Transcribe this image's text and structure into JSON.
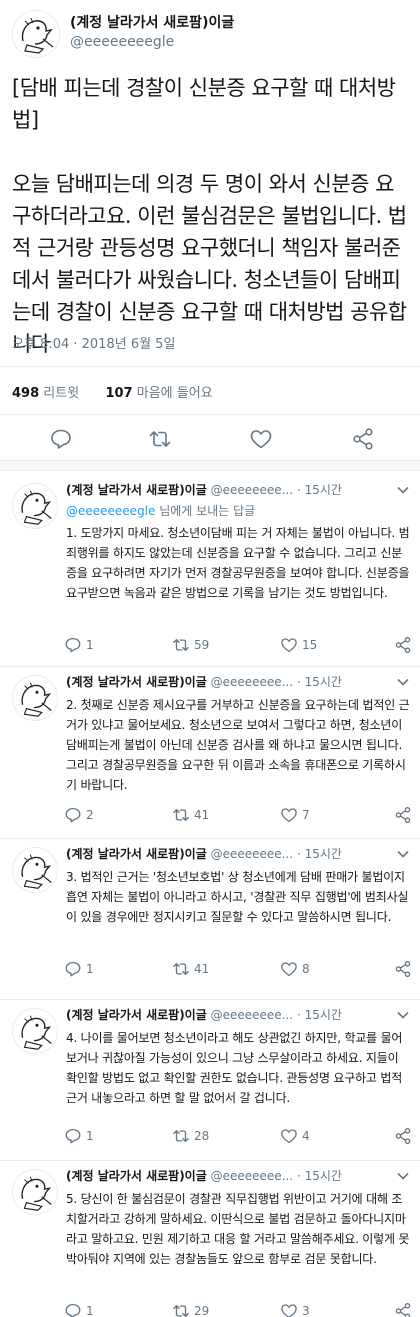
{
  "main_tweet": {
    "display_name": "(계정 날라가서 새로팜)이글",
    "handle": "@eeeeeeeegle",
    "body_title": "[담배 피는데 경찰이 신분증 요구할 때 대처방법]",
    "body_text": "오늘 담배피는데 의경 두 명이 와서 신분증 요구하더라고요. 이런 불심검문은 불법입니다. 법적 근거랑 관등성명 요구했더니 책임자 불러준데서 불러다가 싸웠습니다. 청소년들이 담배피는데 경찰이 신분증 요구할 때 대처방법 공유합니다",
    "timestamp": "오후 8:04 · 2018년 6월 5일",
    "retweets_count": "498",
    "retweets_label": "리트윗",
    "likes_count": "107",
    "likes_label": "마음에 들어요"
  },
  "replies": [
    {
      "display_name": "(계정 날라가서 새로팜)이글",
      "handle": "@eeeeeeee...",
      "time": "· 15시간",
      "reply_to_handle": "@eeeeeeeegle",
      "reply_to_suffix": " 님에게 보내는 답글",
      "text": "1. 도망가지 마세요. 청소년이담배 피는 거 자체는 불법이 아닙니다. 범죄행위를 하지도 않았는데 신분증을 요구할 수 없습니다. 그리고 신분증을 요구하려면 자기가 먼저 경찰공무원증을 보여야 합니다. 신분증을 요구받으면 녹음과 같은 방법으로 기록을 남기는 것도 방법입니다.",
      "replies_count": "1",
      "retweets_count": "59",
      "likes_count": "15"
    },
    {
      "display_name": "(계정 날라가서 새로팜)이글",
      "handle": "@eeeeeeee...",
      "time": "· 15시간",
      "text": "2. 첫째로 신분증 제시요구를 거부하고 신분증을 요구하는데 법적인 근거가 있냐고 물어보세요. 청소년으로 보여서 그렇다고 하면, 청소년이 담배피는게 불법이 아닌데 신분증 검사를 왜 하냐고 물으시면 됩니다. 그리고 경찰공무원증을 요구한 뒤 이름과 소속을 휴대폰으로 기록하시기 바랍니다.",
      "replies_count": "2",
      "retweets_count": "41",
      "likes_count": "7"
    },
    {
      "display_name": "(계정 날라가서 새로팜)이글",
      "handle": "@eeeeeeee...",
      "time": "· 15시간",
      "text": "3. 법적인 근거는 '청소년보호법' 상 청소년에게 담배 판매가 불법이지 흡연 자체는 불법이 아니라고 하시고, '경찰관 직무 집행법'에 범죄사실이 있을 경우에만 정지시키고 질문할 수 있다고 말씀하시면 됩니다.",
      "replies_count": "1",
      "retweets_count": "41",
      "likes_count": "8"
    },
    {
      "display_name": "(계정 날라가서 새로팜)이글",
      "handle": "@eeeeeeee...",
      "time": "· 15시간",
      "text": "4. 나이를 물어보면 청소년이라고 해도 상관없긴 하지만, 학교를 물어보거나 귀찮아질 가능성이 있으니 그냥 스무살이라고 하세요. 지들이 확인할 방법도 없고 확인할 권한도 없습니다. 관등성명 요구하고 법적근거 내놓으라고 하면 할 말 없어서 갈 겁니다.",
      "replies_count": "1",
      "retweets_count": "28",
      "likes_count": "4"
    },
    {
      "display_name": "(계정 날라가서 새로팜)이글",
      "handle": "@eeeeeeee...",
      "time": "· 15시간",
      "text": "5. 당신이 한 불심검문이 경찰관 직무집행법 위반이고 거기에 대해 조치할거라고 강하게 말하세요. 이딴식으로 불법 검문하고 돌아다니지마라고 말하고요. 민원 제기하고 대응 할 거라고 말씀해주세요. 이렇게 못박아둬야 지역에 있는 경찰놈들도 앞으로 함부로 검문 못합니다.",
      "replies_count": "1",
      "retweets_count": "29",
      "likes_count": "3"
    }
  ],
  "colors": {
    "text": "#14171a",
    "secondary": "#657786",
    "link": "#1da1f2",
    "border": "#e6ecf0",
    "divider_bg": "#f5f8fa"
  },
  "icons": {
    "reply": "reply-icon",
    "retweet": "retweet-icon",
    "like": "heart-icon",
    "share": "share-icon",
    "caret": "chevron-down-icon",
    "avatar": "eagle-cartoon-avatar"
  }
}
